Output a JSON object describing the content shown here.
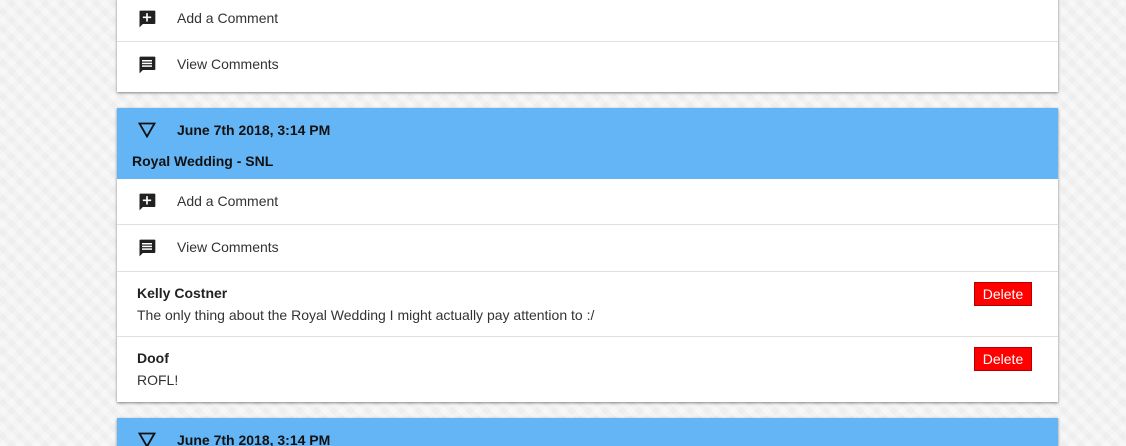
{
  "colors": {
    "header_bg": "#64b5f6",
    "delete_bg": "#ff0000",
    "delete_text": "#ffffff"
  },
  "icons": {
    "add": "add-comment-icon",
    "view": "view-comments-icon",
    "toggle": "collapse-caret-icon"
  },
  "posts": [
    {
      "actions": {
        "add_label": "Add a Comment",
        "view_label": "View Comments"
      }
    },
    {
      "date": "June 7th 2018, 3:14 PM",
      "title": "Royal Wedding - SNL",
      "actions": {
        "add_label": "Add a Comment",
        "view_label": "View Comments"
      },
      "comments": [
        {
          "author": "Kelly Costner",
          "text": "The only thing about the Royal Wedding I might actually pay attention to :/",
          "delete_label": "Delete"
        },
        {
          "author": "Doof",
          "text": "ROFL!",
          "delete_label": "Delete"
        }
      ]
    },
    {
      "date": "June 7th 2018, 3:14 PM"
    }
  ]
}
